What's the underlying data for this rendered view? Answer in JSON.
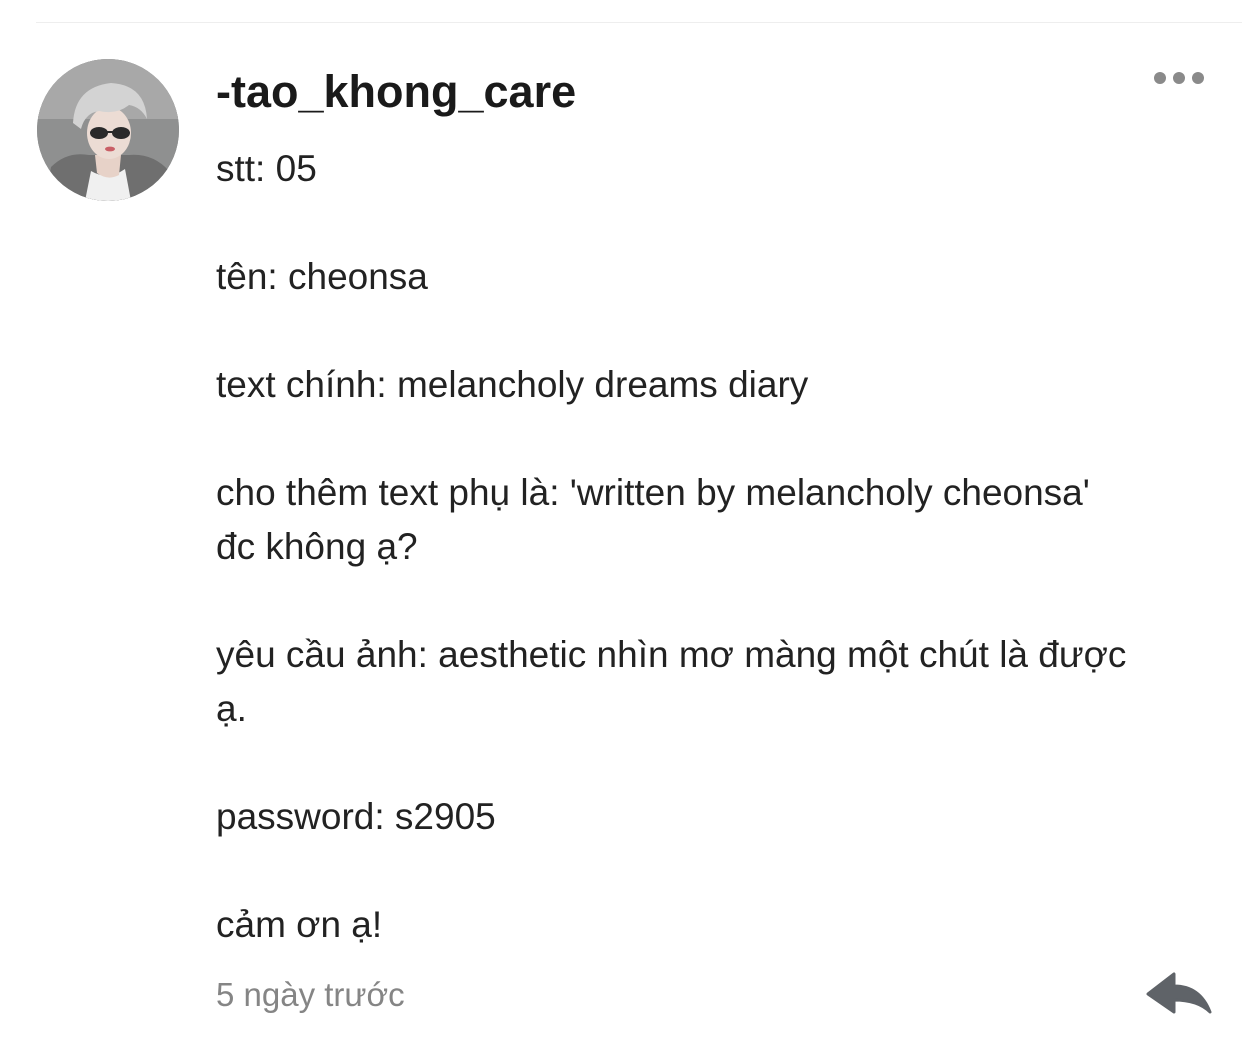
{
  "comment": {
    "author": "-tao_khong_care",
    "lines": [
      "stt: 05",
      "tên: cheonsa",
      "text chính: melancholy dreams diary",
      "cho thêm text phụ là: 'written by melancholy cheonsa'",
      "đc không ạ?",
      "yêu cầu ảnh: aesthetic nhìn mơ màng một chút là được",
      "ạ.",
      "password: s2905",
      "cảm ơn ạ!"
    ],
    "timestamp": "5 ngày trước"
  },
  "icons": {
    "more": "more-horizontal-icon",
    "reply": "reply-arrow-icon"
  },
  "colors": {
    "text": "#222222",
    "muted": "#858585",
    "icon": "#8a8a8a",
    "reply_icon": "#5f6368"
  }
}
